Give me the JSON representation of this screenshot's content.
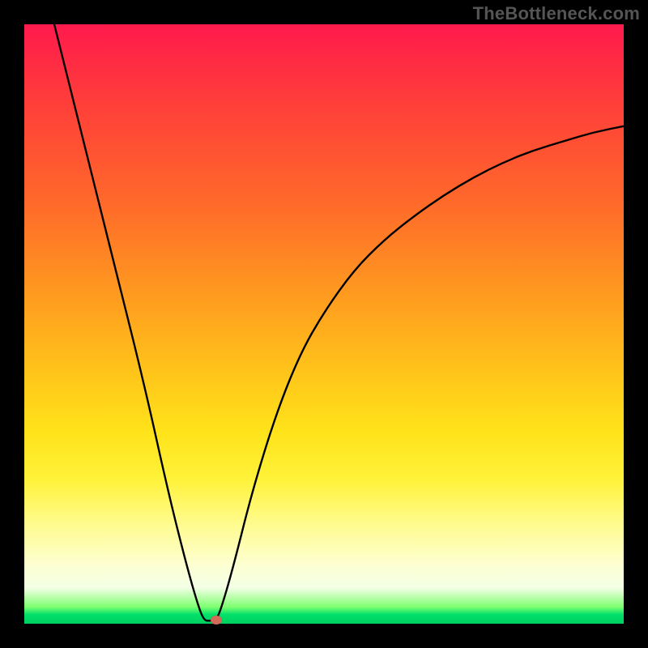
{
  "watermark": "TheBottleneck.com",
  "chart_data": {
    "type": "line",
    "title": "",
    "xlabel": "",
    "ylabel": "",
    "xlim": [
      0,
      100
    ],
    "ylim": [
      0,
      100
    ],
    "grid": false,
    "legend": false,
    "series": [
      {
        "name": "bottleneck-curve",
        "x": [
          5,
          10,
          15,
          20,
          24,
          27,
          29,
          30,
          31,
          32,
          33,
          35,
          38,
          42,
          46,
          50,
          55,
          60,
          65,
          70,
          75,
          80,
          85,
          90,
          95,
          100
        ],
        "y": [
          100,
          80,
          60,
          40,
          22,
          10,
          3,
          0.5,
          0.5,
          0.5,
          3,
          10,
          22,
          35,
          45,
          52,
          59,
          64,
          68,
          71.5,
          74.5,
          77,
          79,
          80.5,
          82,
          83
        ]
      }
    ],
    "annotations": [
      {
        "type": "flat-min",
        "x_range": [
          29.5,
          31.5
        ],
        "y": 0.5
      }
    ],
    "marker": {
      "x": 32,
      "y": 0.5,
      "color": "#d46a5a"
    },
    "background_gradient": {
      "direction": "vertical",
      "stops": [
        {
          "pos": 0,
          "color": "#ff1a4d"
        },
        {
          "pos": 30,
          "color": "#ff6a2a"
        },
        {
          "pos": 58,
          "color": "#ffc41a"
        },
        {
          "pos": 76,
          "color": "#fff23a"
        },
        {
          "pos": 90,
          "color": "#fdffd0"
        },
        {
          "pos": 98,
          "color": "#00e06a"
        },
        {
          "pos": 100,
          "color": "#00d060"
        }
      ]
    }
  }
}
